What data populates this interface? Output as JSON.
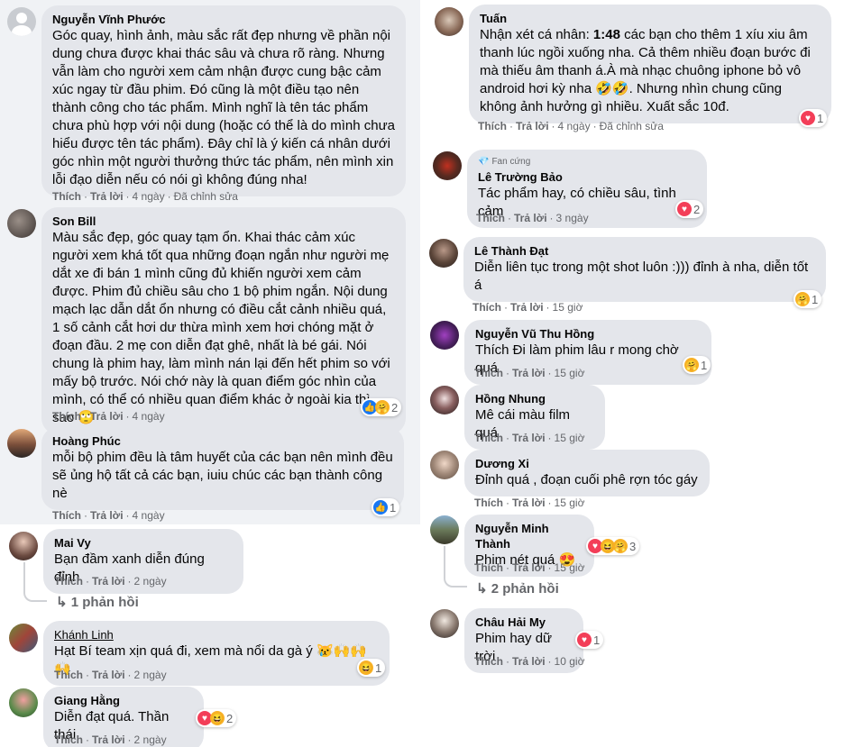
{
  "colors": {
    "bubble": "#e4e6eb",
    "meta_text": "#65676b",
    "like_blue": "#1877f2",
    "love_red": "#f33e58",
    "haha_yellow": "#f7b125"
  },
  "common": {
    "like": "Thích",
    "reply": "Trả lời",
    "sep": "·"
  },
  "left": [
    {
      "name": "Nguyễn Vĩnh Phước",
      "text": "Góc quay, hình ảnh, màu sắc rất đẹp nhưng về phần nội dung chưa được khai thác sâu và chưa rõ ràng. Nhưng vẫn làm cho người xem cảm nhận được cung bậc cảm xúc ngay từ đầu phim. Đó cũng là một điều tạo nên thành công cho tác phẩm. Mình nghĩ là tên tác phẩm chưa phù hợp với nội dung (hoặc có thể là do mình chưa hiểu được tên tác phẩm). Đây chỉ là ý kiến cá nhân dưới góc nhìn một người thưởng thức tác phẩm, nên mình xin lỗi đạo diễn nếu có nói gì không đúng nha!",
      "time": "4 ngày",
      "edited": "Đã chỉnh sửa"
    },
    {
      "name": "Son Bill",
      "text": "Màu sắc đẹp, góc quay tạm ổn. Khai thác cảm xúc người xem khá tốt qua những đoạn ngắn như người mẹ dắt xe đi bán 1 mình cũng đủ khiến người xem cảm được. Phim đủ chiều sâu cho 1 bộ phim ngắn. Nội dung mạch lạc dẫn dắt ổn nhưng có điều cắt cảnh nhiều quá, 1 số cảnh cắt hơi dư thừa mình xem hơi chóng mặt ở đoạn đầu. 2 mẹ con diễn đạt ghê, nhất là bé gái. Nói chung là phim hay, làm mình nán lại đến hết phim so với mấy bộ trước. Nói chớ này là quan điểm góc nhìn của mình, có thể có nhiều quan điểm khác ở ngoài kia thì sao 🙄",
      "time": "4 ngày",
      "reaction_count": "2"
    },
    {
      "name": "Hoàng Phúc",
      "text": "mỗi bộ phim đều là tâm huyết của các bạn nên mình đều sẽ ủng hộ tất cả các bạn, iuiu chúc các bạn thành công nè",
      "time": "4 ngày",
      "reaction_count": "1"
    },
    {
      "name": "Mai Vy",
      "text": "Bạn đầm xanh diễn đúng đỉnh",
      "time": "2 ngày",
      "replies": "1 phản hồi"
    },
    {
      "name": "Khánh Linh",
      "text": "Hạt Bí team xịn quá đi, xem mà nổi da gà ý 😿🙌🙌🙌",
      "time": "2 ngày",
      "reaction_count": "1"
    },
    {
      "name": "Giang Hằng",
      "text": "Diễn đạt quá. Thần thái",
      "time": "2 ngày",
      "reaction_count": "2"
    }
  ],
  "right": [
    {
      "name": "Tuấn",
      "text_prefix": "Nhận xét cá nhân: ",
      "text_bold": "1:48",
      "text_rest": " các bạn cho thêm 1 xíu xiu âm thanh lúc ngồi xuống nha. Cả thêm nhiều đoạn bước đi mà thiếu âm thanh á.À mà nhạc chuông iphone bỏ vô android hơi kỳ nha 🤣🤣. Nhưng nhìn chung cũng không ảnh hưởng gì nhiều. Xuất sắc 10đ.",
      "time": "4 ngày",
      "edited": "Đã chỉnh sửa",
      "reaction_count": "1"
    },
    {
      "badge": "Fan cứng",
      "name": "Lê Trường Bảo",
      "text": "Tác phẩm hay, có chiều sâu, tình cảm",
      "time": "3 ngày",
      "reaction_count": "2"
    },
    {
      "name": "Lê Thành Đạt",
      "text": "Diễn liên tục trong một shot luôn :))) đỉnh à nha, diễn tốt á",
      "time": "15 giờ",
      "reaction_count": "1"
    },
    {
      "name": "Nguyễn Vũ Thu Hồng",
      "text": "Thích Đi làm phim lâu r mong chờ quá",
      "time": "15 giờ",
      "reaction_count": "1"
    },
    {
      "name": "Hồng Nhung",
      "text": "Mê cái màu film quá",
      "time": "15 giờ"
    },
    {
      "name": "Dương Xi",
      "text": "Đỉnh quá , đoạn cuối phê rợn tóc gáy",
      "time": "15 giờ"
    },
    {
      "name": "Nguyễn Minh Thành",
      "text": "Phim nét quá 😍",
      "time": "15 giờ",
      "reaction_count": "3",
      "replies": "2 phản hồi"
    },
    {
      "name": "Châu Hải My",
      "text": "Phim hay dữ trời",
      "time": "10 giờ",
      "reaction_count": "1"
    }
  ]
}
